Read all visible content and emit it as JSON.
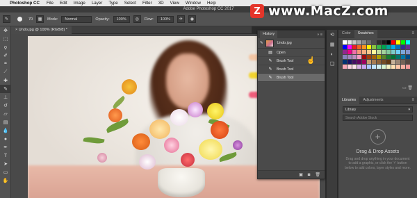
{
  "menubar": {
    "app_name": "Photoshop CC",
    "items": [
      "File",
      "Edit",
      "Image",
      "Layer",
      "Type",
      "Select",
      "Filter",
      "3D",
      "View",
      "Window",
      "Help"
    ]
  },
  "window": {
    "title": "Adobe Photoshop CC 2017"
  },
  "options": {
    "brush_size": "70",
    "mode_label": "Mode:",
    "mode_value": "Normal",
    "opacity_label": "Opacity:",
    "opacity_value": "100%",
    "flow_label": "Flow:",
    "flow_value": "100%"
  },
  "document": {
    "tab_label": "Undo.jpg @ 100% (RGB/8) *"
  },
  "history": {
    "tab_label": "History",
    "snapshot_label": "Undo.jpg",
    "items": [
      {
        "label": "Open",
        "icon": "document-icon"
      },
      {
        "label": "Brush Tool",
        "icon": "brush-icon"
      },
      {
        "label": "Brush Tool",
        "icon": "brush-icon"
      },
      {
        "label": "Brush Tool",
        "icon": "brush-icon"
      }
    ]
  },
  "swatches_panel": {
    "tabs": [
      "Color",
      "Swatches"
    ]
  },
  "libraries_panel": {
    "tabs": [
      "Libraries",
      "Adjustments"
    ],
    "library_select": "Library",
    "search_placeholder": "Search Adobe Stock",
    "drop_title": "Drag & Drop Assets",
    "drop_text": "Drag and drop anything in your document to add a graphic, or click the '+' button below to add colors, layer styles and more."
  },
  "watermark": {
    "logo_letter": "Z",
    "text": "www.MacZ.com"
  },
  "colors": {
    "accent_red": "#e4352a",
    "panel_bg": "#4a4a4a",
    "selected_row": "#6a6a6a"
  }
}
